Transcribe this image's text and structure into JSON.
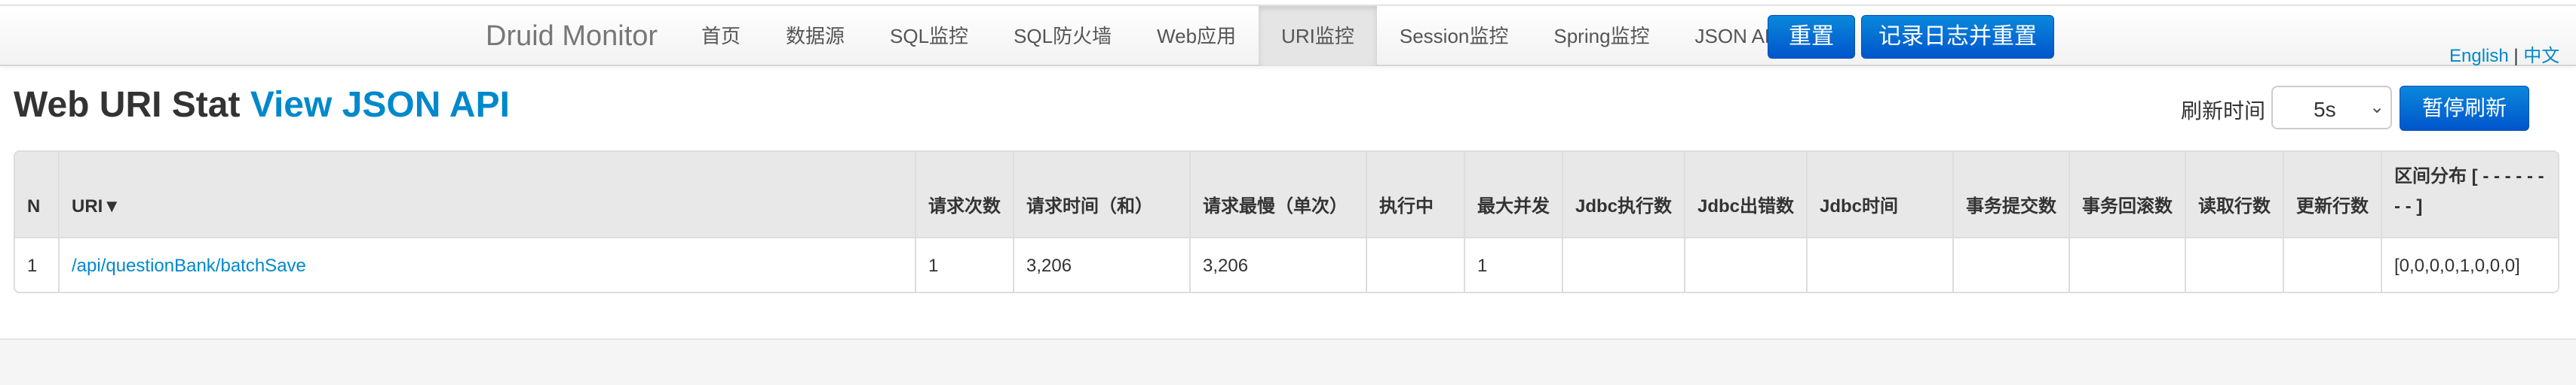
{
  "navbar": {
    "brand": "Druid Monitor",
    "items": [
      {
        "label": "首页",
        "active": false
      },
      {
        "label": "数据源",
        "active": false
      },
      {
        "label": "SQL监控",
        "active": false
      },
      {
        "label": "SQL防火墙",
        "active": false
      },
      {
        "label": "Web应用",
        "active": false
      },
      {
        "label": "URI监控",
        "active": true
      },
      {
        "label": "Session监控",
        "active": false
      },
      {
        "label": "Spring监控",
        "active": false
      },
      {
        "label": "JSON API",
        "active": false
      }
    ],
    "reset_label": "重置",
    "log_reset_label": "记录日志并重置",
    "lang_en": "English",
    "lang_sep": "|",
    "lang_zh": "中文"
  },
  "header": {
    "title": "Web URI Stat",
    "json_link": "View JSON API",
    "refresh_label": "刷新时间",
    "refresh_value": "5s",
    "pause_label": "暂停刷新"
  },
  "table": {
    "columns": [
      "N",
      "URI▼",
      "请求次数",
      "请求时间（和）",
      "请求最慢（单次）",
      "执行中",
      "最大并发",
      "Jdbc执行数",
      "Jdbc出错数",
      "Jdbc时间",
      "事务提交数",
      "事务回滚数",
      "读取行数",
      "更新行数",
      "区间分布 [ - - - - - - - - ]"
    ],
    "rows": [
      [
        "1",
        "/api/questionBank/batchSave",
        "1",
        "3,206",
        "3,206",
        "",
        "1",
        "",
        "",
        "",
        "",
        "",
        "",
        "",
        "[0,0,0,0,1,0,0,0]"
      ]
    ]
  },
  "colors": {
    "accent": "#0088cc",
    "button": "#0055cc"
  }
}
